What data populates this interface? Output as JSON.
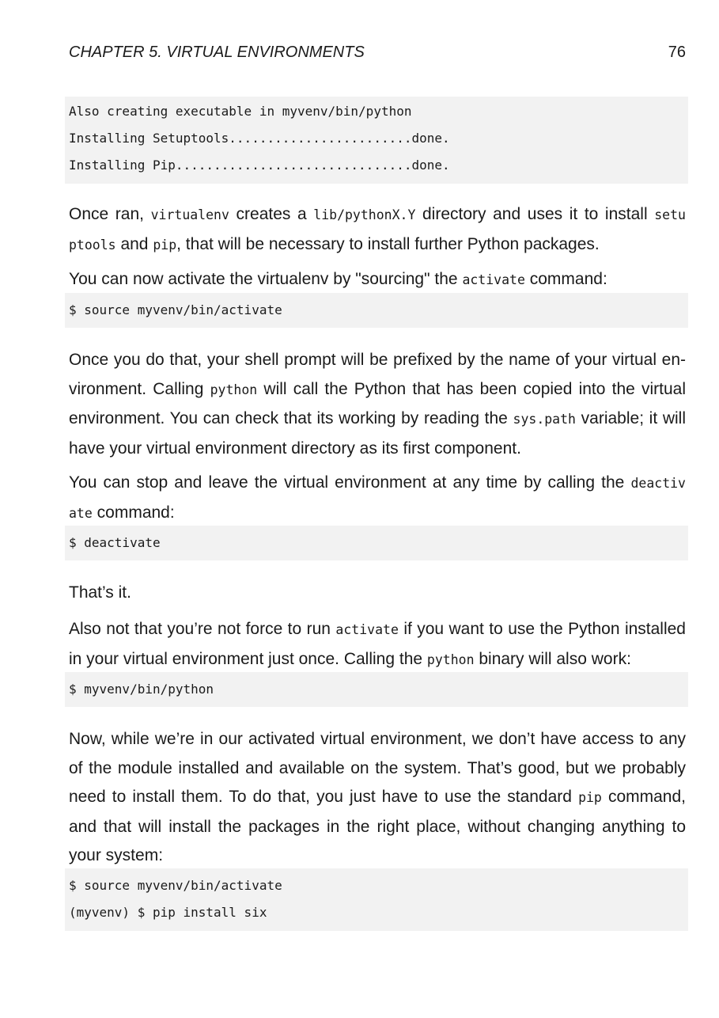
{
  "header": {
    "chapter": "CHAPTER 5.  VIRTUAL ENVIRONMENTS",
    "page_number": "76"
  },
  "code1": [
    "Also creating executable in myvenv/bin/python",
    "Installing Setuptools........................done.",
    "Installing Pip...............................done."
  ],
  "para1": {
    "t1": "Once ran, ",
    "c1": "virtualenv",
    "t2": " creates a ",
    "c2": "lib/pythonX.Y",
    "t3": " directory and uses it to install ",
    "c3": "setu ptools",
    "t4": " and ",
    "c4": "pip",
    "t5": ", that will be necessary to install further Python packages."
  },
  "para2": {
    "t1": "You can now activate the virtualenv by \"sourcing\" the ",
    "c1": "activate",
    "t2": " command:"
  },
  "code2": [
    "$ source myvenv/bin/activate"
  ],
  "para3": {
    "t1": "Once you do that, your shell prompt will be prefixed by the name of your virtual en-vironment. Calling ",
    "c1": "python",
    "t2": " will call the Python that has been copied into the virtual environment.  You can check that its working by reading the ",
    "c2": "sys.path",
    "t3": " variable; it will have your virtual environment directory as its first component."
  },
  "para4": {
    "t1": "You can stop and leave the virtual environment at any time by calling the ",
    "c1": "deactiv ate",
    "t2": " command:"
  },
  "code3": [
    "$ deactivate"
  ],
  "para5": {
    "t1": "That’s it."
  },
  "para6": {
    "t1": "Also not that you’re not force to run ",
    "c1": "activate",
    "t2": " if you want to use the Python installed in your virtual environment just once.  Calling the ",
    "c2": "python",
    "t3": " binary will also work:"
  },
  "code4": [
    "$ myvenv/bin/python"
  ],
  "para7": {
    "t1": "Now, while we’re in our activated virtual environment, we don’t have access to any of the module installed and available on the system.  That’s good, but we probably need to install them.  To do that, you just have to use the standard ",
    "c1": "pip",
    "t2": " command, and that will install the packages in the right place, without changing anything to your system:"
  },
  "code5": [
    "$ source myvenv/bin/activate",
    "(myvenv) $ pip install six"
  ]
}
